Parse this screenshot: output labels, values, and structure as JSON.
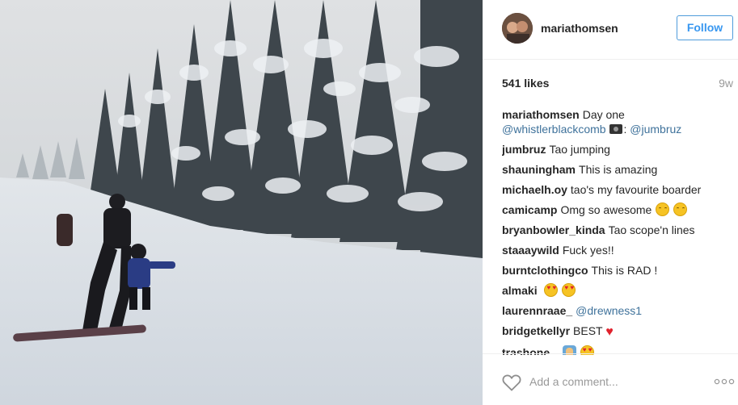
{
  "post": {
    "username": "mariathomsen",
    "follow_label": "Follow",
    "likes": "541 likes",
    "time_ago": "9w"
  },
  "comments": [
    {
      "user": "mariathomsen",
      "text": "Day one",
      "mention1": "@whistlerblackcomb",
      "sep": ":",
      "mention2": "@jumbruz"
    },
    {
      "user": "jumbruz",
      "text": "Tao jumping"
    },
    {
      "user": "shauningham",
      "text": "This is amazing"
    },
    {
      "user": "michaelh.oy",
      "text": "tao's my favourite boarder"
    },
    {
      "user": "camicamp",
      "text": "Omg so awesome"
    },
    {
      "user": "bryanbowler_kinda",
      "text": "Tao scope'n lines"
    },
    {
      "user": "staaaywild",
      "text": "Fuck yes!!"
    },
    {
      "user": "burntclothingco",
      "text": "This is RAD !"
    },
    {
      "user": "almaki",
      "text": ""
    },
    {
      "user": "laurennraae_",
      "mention": "@drewness1"
    },
    {
      "user": "bridgetkellyr",
      "text": "BEST"
    },
    {
      "user": "trashone_",
      "text": ""
    }
  ],
  "add_comment": {
    "placeholder": "Add a comment..."
  },
  "icons": {
    "like": "heart-outline-icon",
    "more": "more-options-icon"
  },
  "colors": {
    "follow_text": "#3897f0",
    "mention": "#3f729b",
    "muted": "#999999"
  }
}
